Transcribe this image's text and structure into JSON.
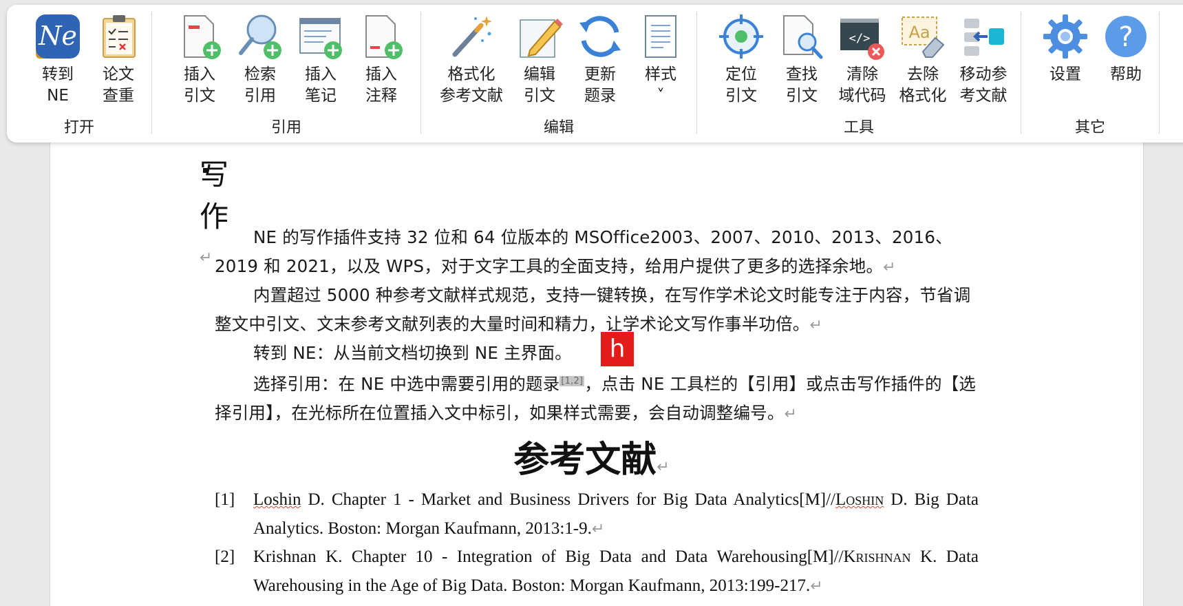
{
  "ribbon": {
    "groups": [
      {
        "label": "打开",
        "buttons": [
          {
            "name": "goto-ne-button",
            "line1": "转到",
            "line2": "NE",
            "icon": "ne-logo-icon"
          },
          {
            "name": "paper-check-button",
            "line1": "论文",
            "line2": "查重",
            "icon": "clipboard-checklist-icon"
          }
        ]
      },
      {
        "label": "引用",
        "buttons": [
          {
            "name": "insert-citation-button",
            "line1": "插入",
            "line2": "引文",
            "icon": "doc-add-icon"
          },
          {
            "name": "search-citation-button",
            "line1": "检索",
            "line2": "引用",
            "icon": "search-add-icon"
          },
          {
            "name": "insert-note-button",
            "line1": "插入",
            "line2": "笔记",
            "icon": "note-add-icon"
          },
          {
            "name": "insert-annotation-button",
            "line1": "插入",
            "line2": "注释",
            "icon": "doc-annotation-add-icon"
          }
        ]
      },
      {
        "label": "编辑",
        "buttons": [
          {
            "name": "format-references-button",
            "line1": "格式化",
            "line2": "参考文献",
            "icon": "magic-wand-icon"
          },
          {
            "name": "edit-citation-button",
            "line1": "编辑",
            "line2": "引文",
            "icon": "pencil-edit-icon"
          },
          {
            "name": "update-bibliography-button",
            "line1": "更新",
            "line2": "题录",
            "icon": "refresh-icon"
          },
          {
            "name": "style-dropdown-button",
            "line1": "样式",
            "line2": "˅",
            "icon": "style-doc-icon"
          }
        ]
      },
      {
        "label": "工具",
        "buttons": [
          {
            "name": "locate-citation-button",
            "line1": "定位",
            "line2": "引文",
            "icon": "target-icon"
          },
          {
            "name": "find-citation-button",
            "line1": "查找",
            "line2": "引文",
            "icon": "doc-search-icon"
          },
          {
            "name": "clear-field-code-button",
            "line1": "清除",
            "line2": "域代码",
            "icon": "code-clear-icon"
          },
          {
            "name": "remove-format-button",
            "line1": "去除",
            "line2": "格式化",
            "icon": "eraser-format-icon"
          },
          {
            "name": "move-references-button",
            "line1": "移动参",
            "line2": "考文献",
            "icon": "move-arrow-icon"
          }
        ]
      },
      {
        "label": "其它",
        "buttons": [
          {
            "name": "settings-button",
            "line1": "设置",
            "line2": "",
            "icon": "gear-icon"
          },
          {
            "name": "help-button",
            "line1": "帮助",
            "line2": "",
            "icon": "help-icon"
          }
        ]
      }
    ]
  },
  "document": {
    "heading": "写作",
    "return_mark": "↵",
    "paragraphs": {
      "p1": "NE 的写作插件支持 32 位和 64 位版本的 MSOffice2003、2007、2010、2013、2016、2019 和 2021，以及 WPS，对于文字工具的全面支持，给用户提供了更多的选择余地。",
      "p2": "内置超过 5000 种参考文献样式规范，支持一键转换，在写作学术论文时能专注于内容，节省调整文中引文、文末参考文献列表的大量时间和精力，让学术论文写作事半功倍。",
      "p3": "转到 NE：从当前文档切换到 NE 主界面。",
      "p4a": "选择引用：在 NE 中选中需要引用的题录",
      "p4_cite": "[1,2]",
      "p4b": "，点击 NE 工具栏的【引用】或点击写作插件的【选择引用】，在光标所在位置插入文中标引，如果样式需要，会自动调整编号。"
    },
    "marker_letter": "h",
    "references_title": "参考文献",
    "references": [
      {
        "num": "[1]",
        "author": "Loshin",
        "text_a": " D. Chapter 1 - Market and Business Drivers for Big Data Analytics[M]//",
        "sc": "Loshin",
        "text_b": " D. Big Data Analytics. Boston: Morgan Kaufmann, 2013:1-9."
      },
      {
        "num": "[2]",
        "author": "Krishnan",
        "text_a": " K. Chapter 10 - Integration of Big Data and Data Warehousing[M]//",
        "sc": "Krishnan",
        "text_b": " K. Data Warehousing in the Age of Big Data. Boston: Morgan Kaufmann, 2013:199-217."
      }
    ]
  },
  "colors": {
    "ne_logo_blue": "#2f64b5",
    "icon_blue": "#3b82d6",
    "plus_green": "#4fbf6a",
    "marker_red": "#e41b1b"
  }
}
